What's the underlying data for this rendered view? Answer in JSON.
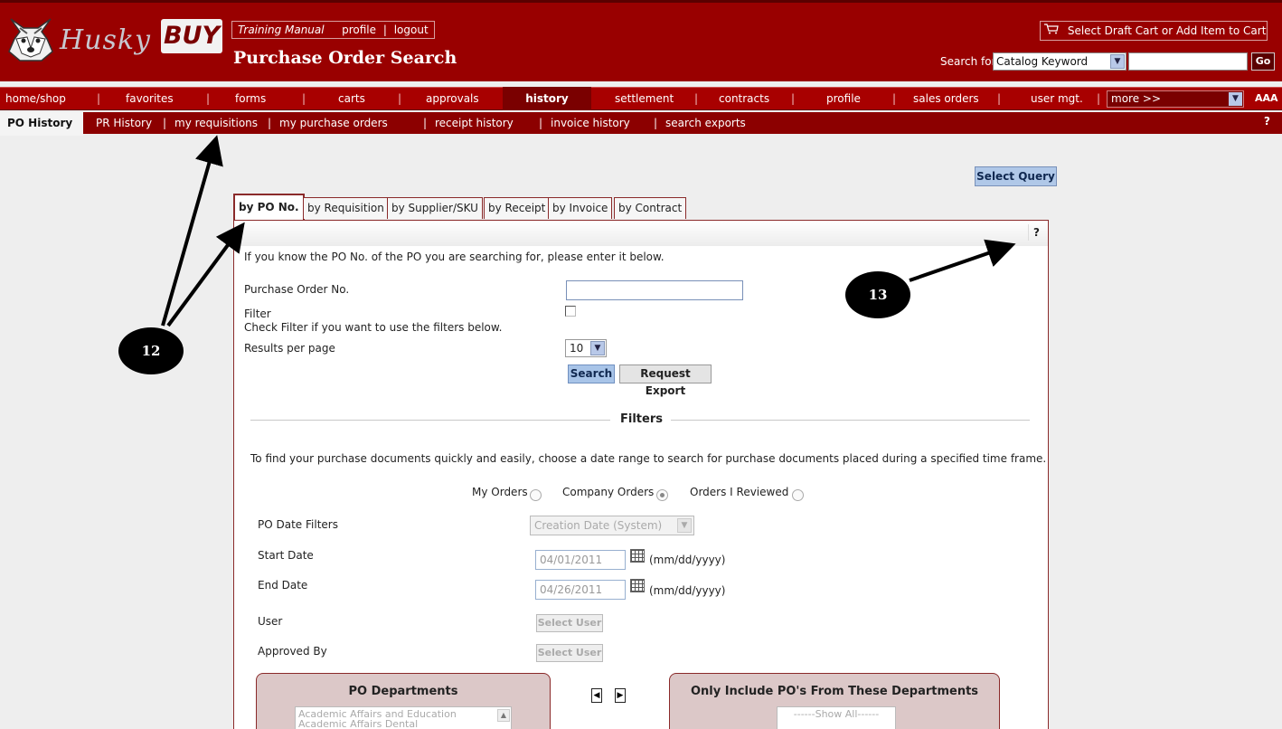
{
  "header": {
    "logo_text": "Husky",
    "logo_buy": "BUY",
    "links": {
      "manual": "Training Manual",
      "profile": "profile",
      "logout": "logout",
      "sep": "|"
    },
    "page_title": "Purchase Order Search",
    "cart_label": "Select Draft Cart or Add Item to Cart",
    "search_label": "Search for",
    "search_scope": "Catalog Keyword",
    "search_value": "",
    "go_label": "Go"
  },
  "main_nav": {
    "items": [
      "home/shop",
      "favorites",
      "forms",
      "carts",
      "approvals",
      "history",
      "settlement",
      "contracts",
      "profile",
      "sales orders",
      "user mgt."
    ],
    "active": "history",
    "more_label": "more >>",
    "font_control": "AAA"
  },
  "sub_nav": {
    "active": "PO History",
    "items": [
      "PR History",
      "my requisitions",
      "my purchase orders",
      "receipt history",
      "invoice history",
      "search exports"
    ],
    "help": "?"
  },
  "toolbar": {
    "select_query": "Select Query"
  },
  "tabs": [
    "by PO No.",
    "by Requisition",
    "by Supplier/SKU",
    "by Receipt",
    "by Invoice",
    "by Contract"
  ],
  "form": {
    "help": "?",
    "intro": "If you know the PO No. of the PO you are searching for, please enter it below.",
    "po_label": "Purchase Order No.",
    "po_value": "",
    "filter_label": "Filter",
    "filter_hint": "Check Filter if you want to use the filters below.",
    "filter_checked": false,
    "results_label": "Results per page",
    "results_value": "10",
    "search_button": "Search",
    "export_button": "Request Export"
  },
  "filters": {
    "title": "Filters",
    "description": "To find your purchase documents quickly and easily, choose a date range to search for purchase documents placed during a specified time frame.",
    "order_options": [
      "My Orders",
      "Company Orders",
      "Orders I Reviewed"
    ],
    "order_selected": "Company Orders",
    "date_filter_label": "PO Date Filters",
    "date_filter_value": "Creation Date (System)",
    "start_label": "Start Date",
    "start_value": "04/01/2011",
    "end_label": "End Date",
    "end_value": "04/26/2011",
    "date_format": "(mm/dd/yyyy)",
    "user_label": "User",
    "approved_label": "Approved By",
    "select_user": "Select User"
  },
  "departments": {
    "left_title": "PO Departments",
    "left_items": [
      "Academic Affairs and Education",
      "Academic Affairs Dental"
    ],
    "right_title": "Only Include PO's From These Departments",
    "right_items": [
      "------Show All------"
    ]
  },
  "annotations": {
    "callout_a": "12",
    "callout_b": "13"
  },
  "colors": {
    "brand": "#990000",
    "nav": "#a80000",
    "subnav": "#8c0000",
    "button_blue": "#a8c4e8"
  },
  "icons": [
    "husky-logo-icon",
    "cart-icon",
    "chevron-down-icon",
    "calendar-icon",
    "arrow-left-icon",
    "arrow-right-icon",
    "help-icon"
  ]
}
